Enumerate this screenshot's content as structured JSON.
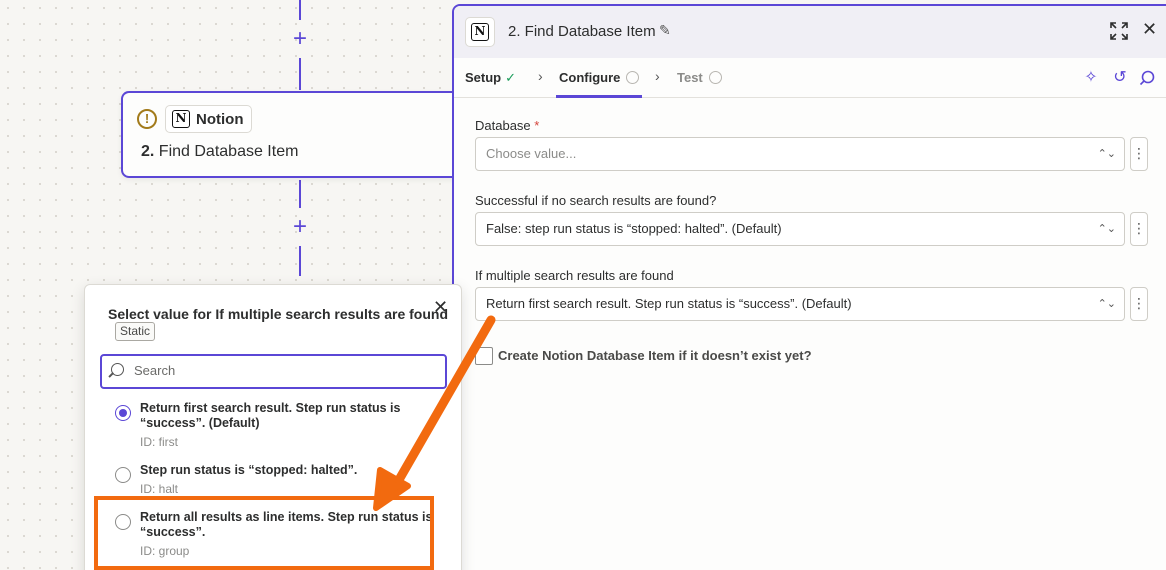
{
  "canvas": {
    "plus_top": "+",
    "plus_bottom": "+"
  },
  "step_card": {
    "app_name": "Notion",
    "step_number": "2.",
    "step_name": "Find Database Item",
    "warning_icon": "warning-icon",
    "logo_letter": "N"
  },
  "panel": {
    "logo_letter": "N",
    "title": "2. Find Database Item",
    "tabs": [
      {
        "label": "Setup",
        "status": "complete"
      },
      {
        "label": "Configure",
        "status": "active"
      },
      {
        "label": "Test",
        "status": "pending"
      }
    ],
    "fields": {
      "database": {
        "label": "Database",
        "required_mark": "*",
        "placeholder": "Choose value..."
      },
      "no_results": {
        "label": "Successful if no search results are found?",
        "value": "False: step run status is “stopped: halted”. (Default)"
      },
      "multiple_results": {
        "label": "If multiple search results are found",
        "value": "Return first search result. Step run status is “success”. (Default)"
      },
      "create_checkbox": {
        "label": "Create Notion Database Item if it doesn’t exist yet?",
        "checked": false
      }
    }
  },
  "popup": {
    "title": "Select value for If multiple search results are found",
    "badge": "Static",
    "search_placeholder": "Search",
    "options": [
      {
        "label": "Return first search result. Step run status is “success”. (Default)",
        "id": "ID: first",
        "selected": true
      },
      {
        "label": "Step run status is “stopped: halted”.",
        "id": "ID: halt",
        "selected": false
      },
      {
        "label": "Return all results as line items. Step run status is “success”.",
        "id": "ID: group",
        "selected": false
      }
    ]
  },
  "annotation": {
    "color": "#f26a0f"
  },
  "colors": {
    "accent": "#5b47d6",
    "success": "#1a9c5a",
    "required": "#d4433b"
  }
}
